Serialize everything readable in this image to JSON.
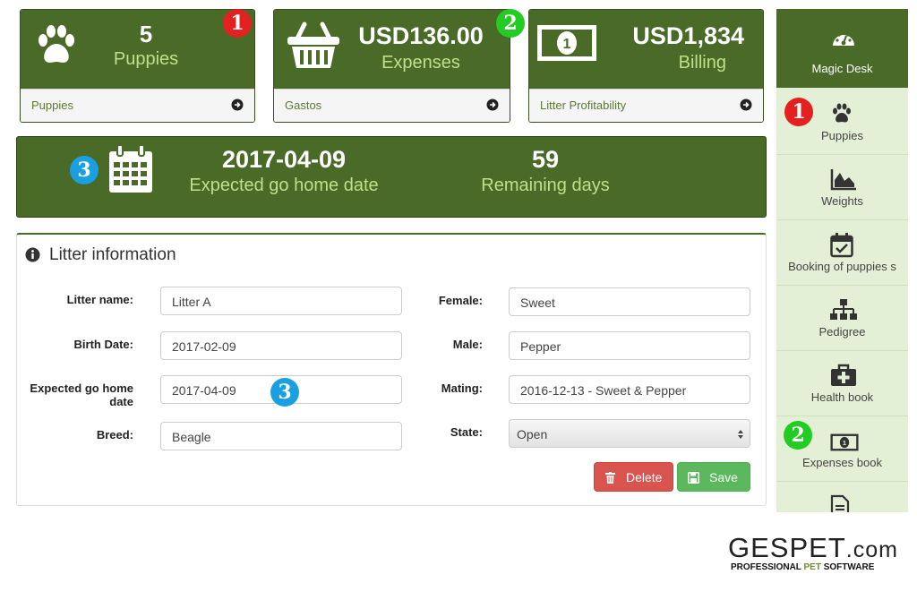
{
  "stats": [
    {
      "value": "5",
      "label": "Puppies",
      "footer": "Puppies",
      "badge": "1"
    },
    {
      "value": "USD136.00",
      "label": "Expenses",
      "footer": "Gastos",
      "badge": "2"
    },
    {
      "value": "USD1,834",
      "label": "Billing",
      "footer": "Litter Profitability"
    }
  ],
  "banner": {
    "date": "2017-04-09",
    "date_label": "Expected go home date",
    "days": "59",
    "days_label": "Remaining days",
    "badge": "3"
  },
  "litter": {
    "title": "Litter information",
    "fields_left": [
      {
        "label": "Litter name:",
        "value": "Litter A"
      },
      {
        "label": "Birth Date:",
        "value": "2017-02-09"
      },
      {
        "label": "Expected go home date",
        "value": "2017-04-09"
      },
      {
        "label": "Breed:",
        "value": "Beagle"
      }
    ],
    "fields_right": [
      {
        "label": "Female:",
        "value": "Sweet"
      },
      {
        "label": "Male:",
        "value": "Pepper"
      },
      {
        "label": "Mating:",
        "value": "2016-12-13 - Sweet & Pepper"
      },
      {
        "label": "State:",
        "value": "Open"
      }
    ],
    "field_badge": "3",
    "delete_label": "Delete",
    "save_label": "Save"
  },
  "sidebar": {
    "header": "Magic Desk",
    "items": [
      {
        "label": "Puppies",
        "icon": "paw-icon",
        "badge": "1"
      },
      {
        "label": "Weights",
        "icon": "area-chart-icon"
      },
      {
        "label": "Booking of puppies s",
        "icon": "calendar-check-icon"
      },
      {
        "label": "Pedigree",
        "icon": "sitemap-icon"
      },
      {
        "label": "Health book",
        "icon": "medkit-icon"
      },
      {
        "label": "Expenses book",
        "icon": "money-icon",
        "badge": "2"
      },
      {
        "label": "",
        "icon": "file-icon"
      }
    ]
  },
  "logo": {
    "brand": "GESPET",
    "tld": ".com",
    "tagline_a": "PROFESSIONAL ",
    "tagline_b": "PET",
    "tagline_c": " SOFTWARE"
  },
  "colors": {
    "primary": "#4a6a28",
    "accent_text": "#bfe08a",
    "sidebar_bg": "#e4f0d6",
    "danger": "#d9534f",
    "success": "#5cb85c"
  }
}
